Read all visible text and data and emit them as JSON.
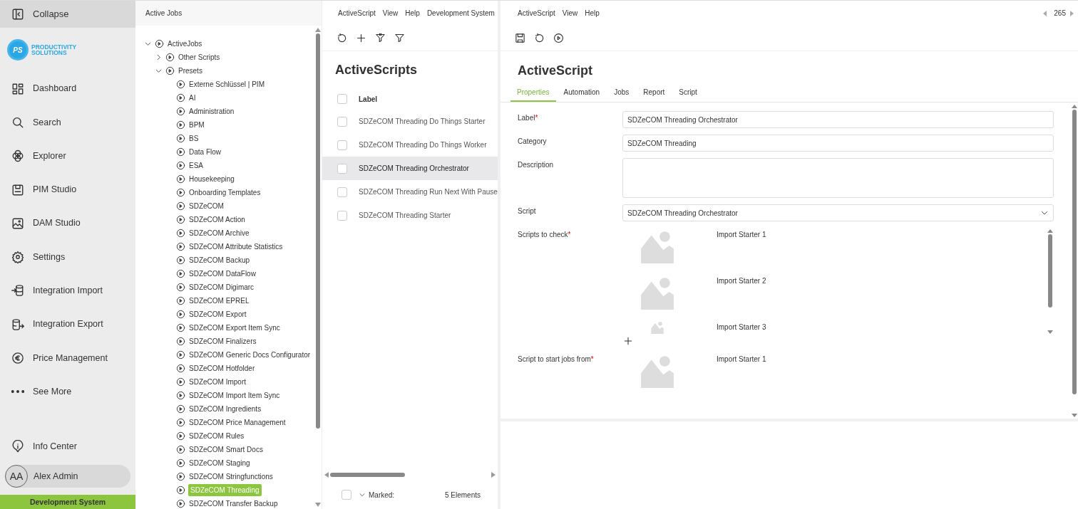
{
  "sidebar": {
    "collapse": "Collapse",
    "logo": {
      "line1": "PRODUCTIVITY",
      "line2": "SOLUTIONS",
      "mark": "PS"
    },
    "items": [
      {
        "label": "Dashboard",
        "kind": "dashboard"
      },
      {
        "label": "Search",
        "kind": "search"
      },
      {
        "label": "Explorer",
        "kind": "explorer"
      },
      {
        "label": "PIM Studio",
        "kind": "pim"
      },
      {
        "label": "DAM Studio",
        "kind": "dam"
      },
      {
        "label": "Settings",
        "kind": "settings"
      },
      {
        "label": "Integration Import",
        "kind": "import"
      },
      {
        "label": "Integration Export",
        "kind": "export"
      },
      {
        "label": "Price Management",
        "kind": "price"
      },
      {
        "label": "See More",
        "kind": "more"
      }
    ],
    "info": "Info Center",
    "user": {
      "initials": "AA",
      "name": "Alex Admin"
    },
    "environment": "Development System"
  },
  "tree_panel": {
    "title": "Active Jobs",
    "tree": [
      {
        "label": "ActiveJobs",
        "expanded": true,
        "selected": false,
        "children": [
          {
            "label": "Other Scripts",
            "expanded": false,
            "selected": false
          },
          {
            "label": "Presets",
            "expanded": true,
            "selected": false,
            "children": [
              {
                "label": "Externe Schlüssel | PIM",
                "selected": false
              },
              {
                "label": "AI",
                "selected": false
              },
              {
                "label": "Administration",
                "selected": false
              },
              {
                "label": "BPM",
                "selected": false
              },
              {
                "label": "BS",
                "selected": false
              },
              {
                "label": "Data Flow",
                "selected": false
              },
              {
                "label": "ESA",
                "selected": false
              },
              {
                "label": "Housekeeping",
                "selected": false
              },
              {
                "label": "Onboarding Templates",
                "selected": false
              },
              {
                "label": "SDZeCOM",
                "selected": false
              },
              {
                "label": "SDZeCOM Action",
                "selected": false
              },
              {
                "label": "SDZeCOM Archive",
                "selected": false
              },
              {
                "label": "SDZeCOM Attribute Statistics",
                "selected": false
              },
              {
                "label": "SDZeCOM Backup",
                "selected": false
              },
              {
                "label": "SDZeCOM DataFlow",
                "selected": false
              },
              {
                "label": "SDZeCOM Digimarc",
                "selected": false
              },
              {
                "label": "SDZeCOM EPREL",
                "selected": false
              },
              {
                "label": "SDZeCOM Export",
                "selected": false
              },
              {
                "label": "SDZeCOM Export Item Sync",
                "selected": false
              },
              {
                "label": "SDZeCOM Finalizers",
                "selected": false
              },
              {
                "label": "SDZeCOM Generic Docs Configurator",
                "selected": false
              },
              {
                "label": "SDZeCOM Hotfolder",
                "selected": false
              },
              {
                "label": "SDZeCOM Import",
                "selected": false
              },
              {
                "label": "SDZeCOM Import Item Sync",
                "selected": false
              },
              {
                "label": "SDZeCOM Ingredients",
                "selected": false
              },
              {
                "label": "SDZeCOM Price Management",
                "selected": false
              },
              {
                "label": "SDZeCOM Rules",
                "selected": false
              },
              {
                "label": "SDZeCOM Smart Docs",
                "selected": false
              },
              {
                "label": "SDZeCOM Staging",
                "selected": false
              },
              {
                "label": "SDZeCOM Stringfunctions",
                "selected": false
              },
              {
                "label": "SDZeCOM Threading",
                "selected": true
              },
              {
                "label": "SDZeCOM Transfer Backup",
                "selected": false
              }
            ]
          }
        ]
      }
    ]
  },
  "list_panel": {
    "menu": [
      "ActiveScript",
      "View",
      "Help",
      "Development System"
    ],
    "toolbar": [
      {
        "kind": "refresh"
      },
      {
        "kind": "add"
      },
      {
        "kind": "filter-clear"
      },
      {
        "kind": "filter"
      }
    ],
    "title": "ActiveScripts",
    "column": "Label",
    "select_all_checked": false,
    "rows": [
      {
        "label": "SDZeCOM Threading Do Things Starter",
        "selected": false,
        "checked": false
      },
      {
        "label": "SDZeCOM Threading Do Things Worker",
        "selected": false,
        "checked": false
      },
      {
        "label": "SDZeCOM Threading Orchestrator",
        "selected": true,
        "checked": false
      },
      {
        "label": "SDZeCOM Threading Run Next With Pause",
        "selected": false,
        "checked": false
      },
      {
        "label": "SDZeCOM Threading Starter",
        "selected": false,
        "checked": false
      }
    ],
    "footer": {
      "checked": false,
      "marked": "Marked:",
      "count": "5 Elements"
    }
  },
  "detail_panel": {
    "menu": [
      "ActiveScript",
      "View",
      "Help"
    ],
    "record": "265",
    "toolbar": [
      {
        "kind": "save"
      },
      {
        "kind": "refresh"
      },
      {
        "kind": "run"
      }
    ],
    "title": "ActiveScript",
    "tabs": [
      {
        "label": "Properties",
        "selected": true
      },
      {
        "label": "Automation",
        "selected": false
      },
      {
        "label": "Jobs",
        "selected": false
      },
      {
        "label": "Report",
        "selected": false
      },
      {
        "label": "Script",
        "selected": false
      }
    ],
    "fields": [
      {
        "kind": "text",
        "label": "Label",
        "required_mark": "*",
        "value": "SDZeCOM Threading Orchestrator"
      },
      {
        "kind": "text",
        "label": "Category",
        "value": "SDZeCOM Threading"
      },
      {
        "kind": "textarea",
        "label": "Description"
      },
      {
        "kind": "select",
        "label": "Script",
        "value": "SDZeCOM Threading Orchestrator"
      },
      {
        "kind": "list",
        "label": "Scripts to check",
        "required_mark": "*",
        "items": [
          "Import Starter 1",
          "Import Starter 2",
          "Import Starter 3"
        ],
        "addable": true
      },
      {
        "kind": "single",
        "label": "Script to start jobs from",
        "required_mark": "*",
        "items": [
          "Import Starter 1"
        ]
      }
    ]
  }
}
